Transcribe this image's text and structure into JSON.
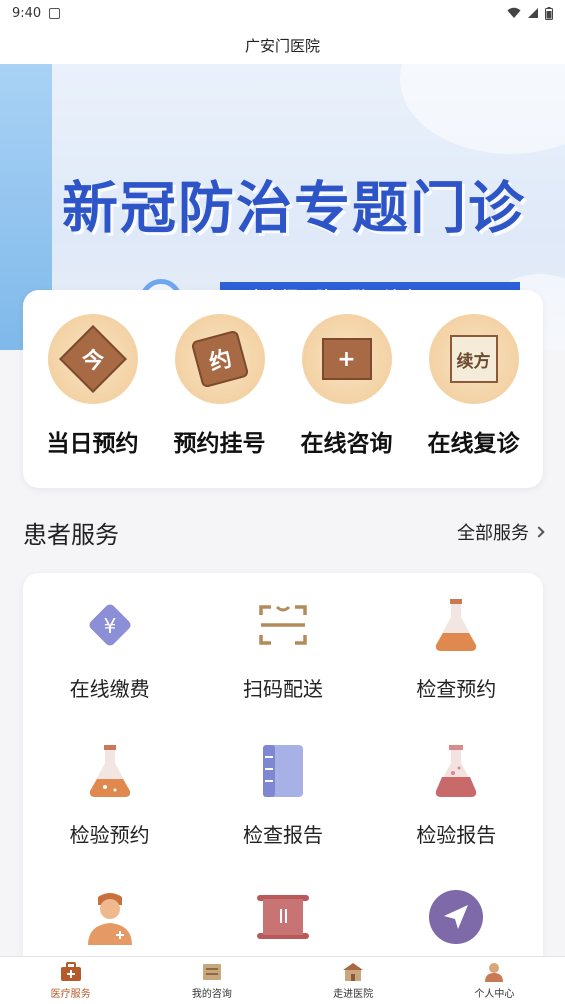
{
  "status_bar": {
    "time": "9:40"
  },
  "header": {
    "title": "广安门医院"
  },
  "banner": {
    "title": "新冠防治专题门诊",
    "subtitle": "广安门医院互联网诊疗"
  },
  "quick_actions": [
    {
      "label": "当日预约",
      "glyph": "今",
      "icon": "today-plaque-icon"
    },
    {
      "label": "预约挂号",
      "glyph": "约",
      "icon": "appointment-tag-icon"
    },
    {
      "label": "在线咨询",
      "glyph": "+",
      "icon": "medical-box-icon"
    },
    {
      "label": "在线复诊",
      "glyph": "续方",
      "icon": "prescription-paper-icon"
    }
  ],
  "patient_services": {
    "title": "患者服务",
    "more_label": "全部服务",
    "items": [
      {
        "label": "在线缴费",
        "icon": "payment-yen-icon"
      },
      {
        "label": "扫码配送",
        "icon": "scan-delivery-icon"
      },
      {
        "label": "检查预约",
        "icon": "exam-flask-icon"
      },
      {
        "label": "检验预约",
        "icon": "lab-flask-icon"
      },
      {
        "label": "检查报告",
        "icon": "report-book-icon"
      },
      {
        "label": "检验报告",
        "icon": "lab-report-flask-icon"
      },
      {
        "label": "",
        "icon": "doctor-icon"
      },
      {
        "label": "",
        "icon": "scroll-icon"
      },
      {
        "label": "",
        "icon": "navigation-icon"
      }
    ]
  },
  "bottom_nav": [
    {
      "label": "医疗服务",
      "icon": "medical-kit-icon",
      "active": true
    },
    {
      "label": "我的咨询",
      "icon": "consult-box-icon",
      "active": false
    },
    {
      "label": "走进医院",
      "icon": "hospital-building-icon",
      "active": false
    },
    {
      "label": "个人中心",
      "icon": "user-avatar-icon",
      "active": false
    }
  ],
  "colors": {
    "banner_title": "#2d55c8",
    "badge_bg": "#f3d2a4",
    "wood": "#a86a45",
    "active_nav": "#b55a2a"
  }
}
